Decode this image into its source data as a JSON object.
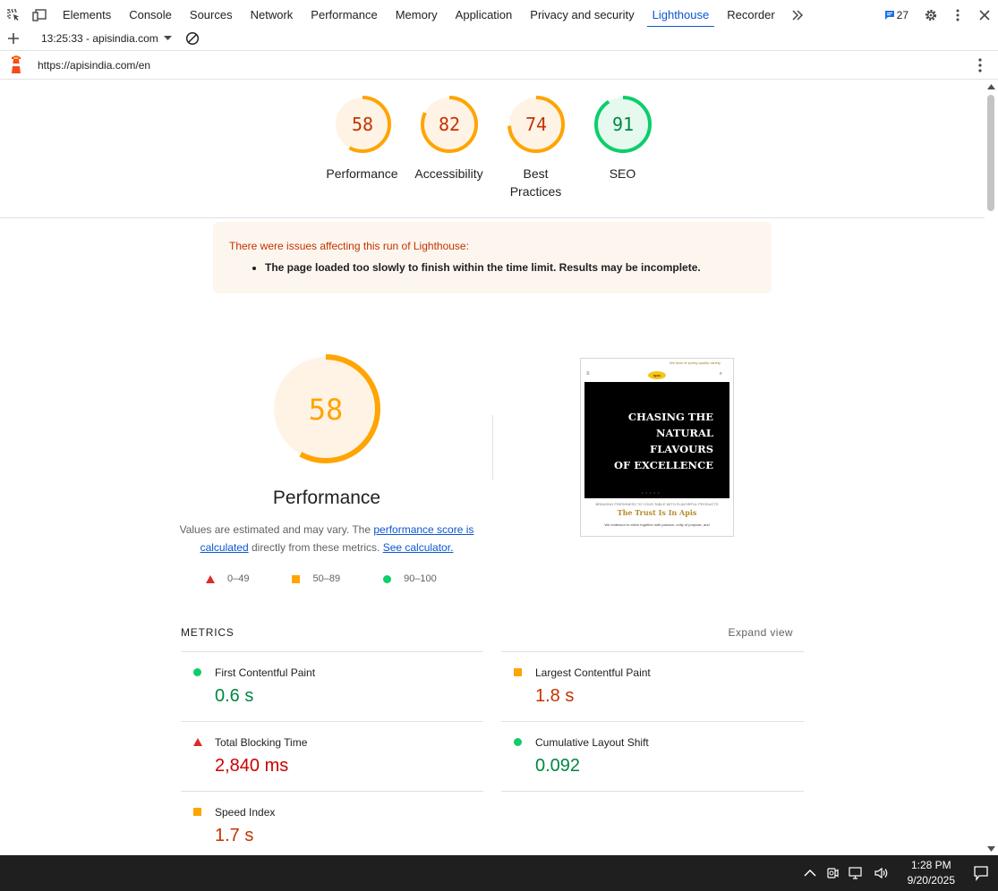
{
  "devtools": {
    "tabs": [
      "Elements",
      "Console",
      "Sources",
      "Network",
      "Performance",
      "Memory",
      "Application",
      "Privacy and security",
      "Lighthouse",
      "Recorder"
    ],
    "active_tab": "Lighthouse",
    "message_count": "27"
  },
  "toolbar": {
    "report_label": "13:25:33 - apisindia.com"
  },
  "url_bar": {
    "url": "https://apisindia.com/en"
  },
  "categories": [
    {
      "name": "Performance",
      "score": "58",
      "score_value": 58,
      "color": "#ffa400",
      "text_color": "#c33300"
    },
    {
      "name": "Accessibility",
      "score": "82",
      "score_value": 82,
      "color": "#ffa400",
      "text_color": "#c33300"
    },
    {
      "name": "Best Practices",
      "score": "74",
      "score_value": 74,
      "color": "#ffa400",
      "text_color": "#c33300"
    },
    {
      "name": "SEO",
      "score": "91",
      "score_value": 91,
      "color": "#0cce6b",
      "text_color": "#018642"
    }
  ],
  "warning": {
    "title": "There were issues affecting this run of Lighthouse:",
    "items": [
      "The page loaded too slowly to finish within the time limit. Results may be incomplete."
    ]
  },
  "performance": {
    "score": "58",
    "score_value": 58,
    "title": "Performance",
    "desc_prefix": "Values are estimated and may vary. The ",
    "desc_link1": "performance score is calculated",
    "desc_middle": " directly from these metrics. ",
    "desc_link2": "See calculator.",
    "legend": [
      "0–49",
      "50–89",
      "90–100"
    ]
  },
  "screenshot": {
    "topbar": "We bear of spring quality variety",
    "logo": "apis",
    "hero_lines": [
      "CHASING THE",
      "NATURAL",
      "FLAVOURS",
      "OF EXCELLENCE"
    ],
    "tagline": "BRINGING FRESHNESS TO YOUR TABLE WITH FLAVORFUL PRODUCTS",
    "trust": "The Trust Is In Apis",
    "body": "We endeavor to strive together with passion, unity of purpose, and"
  },
  "metrics": {
    "header": "METRICS",
    "expand": "Expand view",
    "items": [
      {
        "name": "First Contentful Paint",
        "value": "0.6 s",
        "rating": "good"
      },
      {
        "name": "Largest Contentful Paint",
        "value": "1.8 s",
        "rating": "average"
      },
      {
        "name": "Total Blocking Time",
        "value": "2,840 ms",
        "rating": "poor"
      },
      {
        "name": "Cumulative Layout Shift",
        "value": "0.092",
        "rating": "good"
      },
      {
        "name": "Speed Index",
        "value": "1.7 s",
        "rating": "average"
      }
    ]
  },
  "taskbar": {
    "time": "1:28 PM",
    "date": "9/20/2025"
  }
}
